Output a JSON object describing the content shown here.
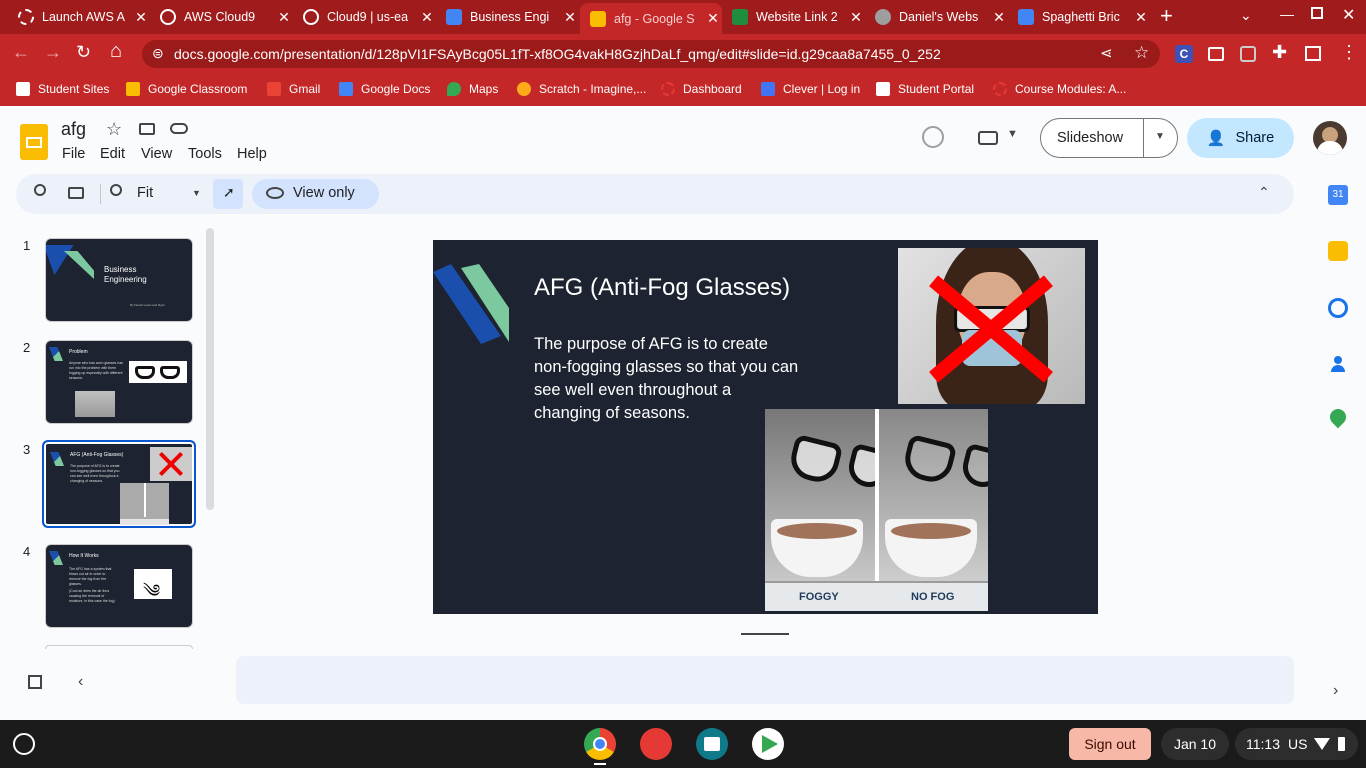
{
  "browser": {
    "tabs": [
      {
        "title": "Launch AWS A",
        "color": "#e53935"
      },
      {
        "title": "AWS Cloud9",
        "color": "#4285f4"
      },
      {
        "title": "Cloud9 | us-ea",
        "color": "#4285f4"
      },
      {
        "title": "Business Engi",
        "color": "#4285f4"
      },
      {
        "title": "afg - Google S",
        "color": "#fbbc04",
        "active": true
      },
      {
        "title": "Website Link 2",
        "color": "#1e8e3e"
      },
      {
        "title": "Daniel's Webs",
        "color": "#9e9e9e"
      },
      {
        "title": "Spaghetti Bric",
        "color": "#4285f4"
      }
    ],
    "new_tab": "+",
    "url": "docs.google.com/presentation/d/128pVI1FSAyBcg05L1fT-xf8OG4vakH8GzjhDaLf_qmg/edit#slide=id.g29caa8a7455_0_252",
    "bookmarks": [
      {
        "label": "Student Sites",
        "color": "#ffffff"
      },
      {
        "label": "Google Classroom",
        "color": "#fbbc04"
      },
      {
        "label": "Gmail",
        "color": "#ea4335"
      },
      {
        "label": "Google Docs",
        "color": "#4285f4"
      },
      {
        "label": "Maps",
        "color": "#34a853"
      },
      {
        "label": "Scratch - Imagine,...",
        "color": "#ffab19"
      },
      {
        "label": "Dashboard",
        "color": "#e53935"
      },
      {
        "label": "Clever | Log in",
        "color": "#4274f6"
      },
      {
        "label": "Student Portal",
        "color": "#ffffff"
      },
      {
        "label": "Course Modules: A...",
        "color": "#e53935"
      }
    ]
  },
  "doc": {
    "title": "afg",
    "menus": [
      "File",
      "Edit",
      "View",
      "Tools",
      "Help"
    ],
    "slideshow_label": "Slideshow",
    "share_label": "Share",
    "zoom": "Fit",
    "view_only_label": "View only"
  },
  "thumbnails": [
    {
      "num": "1",
      "title": "Business Engineering",
      "byline": "By Daniel Lewis and Ryan"
    },
    {
      "num": "2",
      "title": "Problem",
      "body": "Anyone who has worn glasses has run into the problem with them fogging up especially with different seasons."
    },
    {
      "num": "3",
      "title": "AFG (Anti-Fog Glasses)",
      "body": "The purpose of AFG is to create non-fogging glasses so that you can see well even throughout a changing of seasons.",
      "selected": true
    },
    {
      "num": "4",
      "title": "How It Works",
      "body": "The AFG has a system that blows out air in order to remove the fog from the glasses.",
      "body2": "(Cool air dries the air thus causing the removal of moisture, in this case the fog)"
    }
  ],
  "slide": {
    "title": "AFG (Anti-Fog Glasses)",
    "body": "The purpose of AFG is to create non-fogging glasses so that you can see well even throughout a changing of seasons.",
    "caption_left": "FOGGY",
    "caption_right": "NO FOG"
  },
  "shelf": {
    "sign_out": "Sign out",
    "date": "Jan 10",
    "time": "11:13",
    "locale": "US"
  },
  "colors": {
    "chrome_red": "#c42727",
    "slide_bg": "#1d2330",
    "accent_blue": "#1a4fae",
    "accent_green": "#7cc9a0",
    "share_bg": "#c2e7ff"
  }
}
